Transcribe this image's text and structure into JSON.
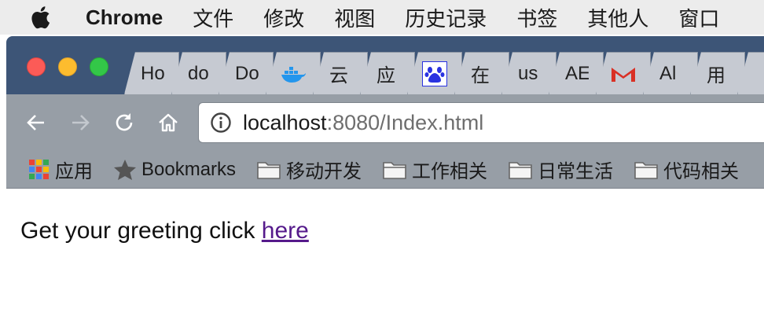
{
  "menubar": {
    "app_name": "Chrome",
    "items": [
      "文件",
      "修改",
      "视图",
      "历史记录",
      "书签",
      "其他人",
      "窗口"
    ]
  },
  "tabs": [
    {
      "label": "Ho",
      "icon": null
    },
    {
      "label": "do",
      "icon": null
    },
    {
      "label": "Do",
      "icon": null
    },
    {
      "label": "",
      "icon": "docker-icon"
    },
    {
      "label": "云",
      "icon": null
    },
    {
      "label": "应",
      "icon": null
    },
    {
      "label": "",
      "icon": "baidu-paw-icon"
    },
    {
      "label": "在",
      "icon": null
    },
    {
      "label": "us",
      "icon": null
    },
    {
      "label": "AE",
      "icon": null
    },
    {
      "label": "",
      "icon": "gmail-icon"
    },
    {
      "label": "Al",
      "icon": null
    },
    {
      "label": "用",
      "icon": null
    }
  ],
  "toolbar": {
    "url_host": "localhost",
    "url_rest": ":8080/Index.html"
  },
  "bookmarks": {
    "apps_label": "应用",
    "bookmarks_label": "Bookmarks",
    "folders": [
      "移动开发",
      "工作相关",
      "日常生活",
      "代码相关"
    ]
  },
  "page": {
    "text": "Get your greeting click ",
    "link": "here"
  },
  "colors": {
    "tabstrip": "#3d5577",
    "toolbar": "#979ea6",
    "link_visited": "#551a8b"
  }
}
